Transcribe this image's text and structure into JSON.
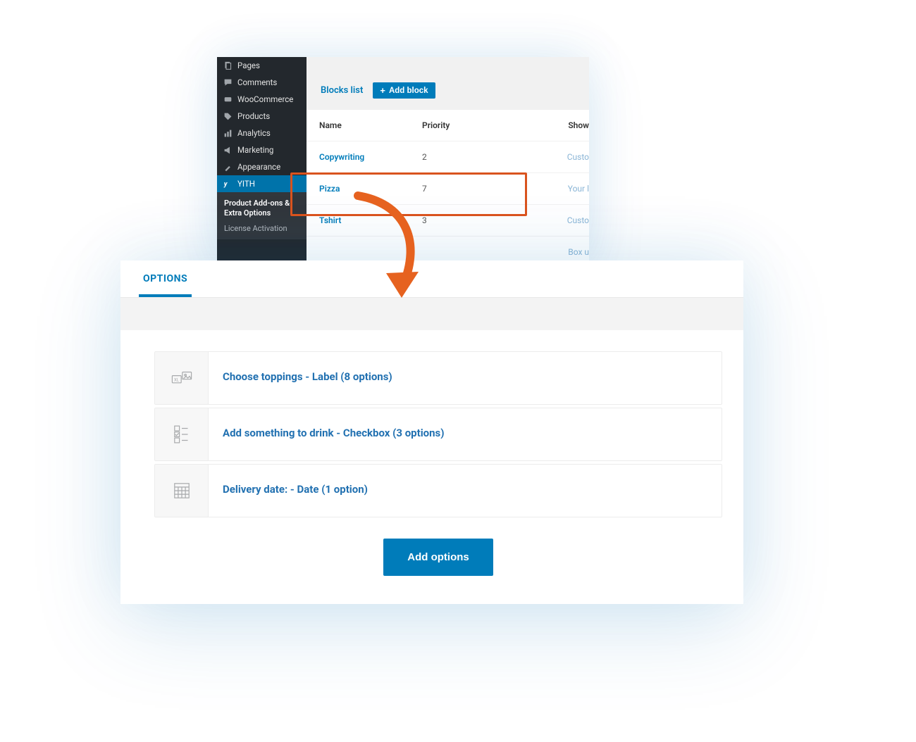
{
  "wp_sidebar": {
    "items": [
      {
        "label": "Pages"
      },
      {
        "label": "Comments"
      },
      {
        "label": "WooCommerce"
      },
      {
        "label": "Products"
      },
      {
        "label": "Analytics"
      },
      {
        "label": "Marketing"
      },
      {
        "label": "Appearance"
      },
      {
        "label": "YITH"
      }
    ],
    "sub": {
      "addons": "Product Add-ons & Extra Options",
      "license": "License Activation"
    }
  },
  "blocks": {
    "title": "Blocks list",
    "add_button": "Add block",
    "columns": {
      "name": "Name",
      "priority": "Priority",
      "show": "Show"
    },
    "rows": [
      {
        "name": "Copywriting",
        "priority": "2",
        "show": "Custo"
      },
      {
        "name": "Pizza",
        "priority": "7",
        "show": "Your l"
      },
      {
        "name": "Tshirt",
        "priority": "3",
        "show": "Custo"
      }
    ],
    "footer_show": "Box u"
  },
  "options": {
    "tab": "OPTIONS",
    "rows": [
      {
        "label": "Choose toppings - Label (8 options)",
        "icon": "label"
      },
      {
        "label": "Add something to drink - Checkbox (3 options)",
        "icon": "checkbox"
      },
      {
        "label": "Delivery date: - Date (1 option)",
        "icon": "calendar"
      }
    ],
    "add_button": "Add options"
  }
}
